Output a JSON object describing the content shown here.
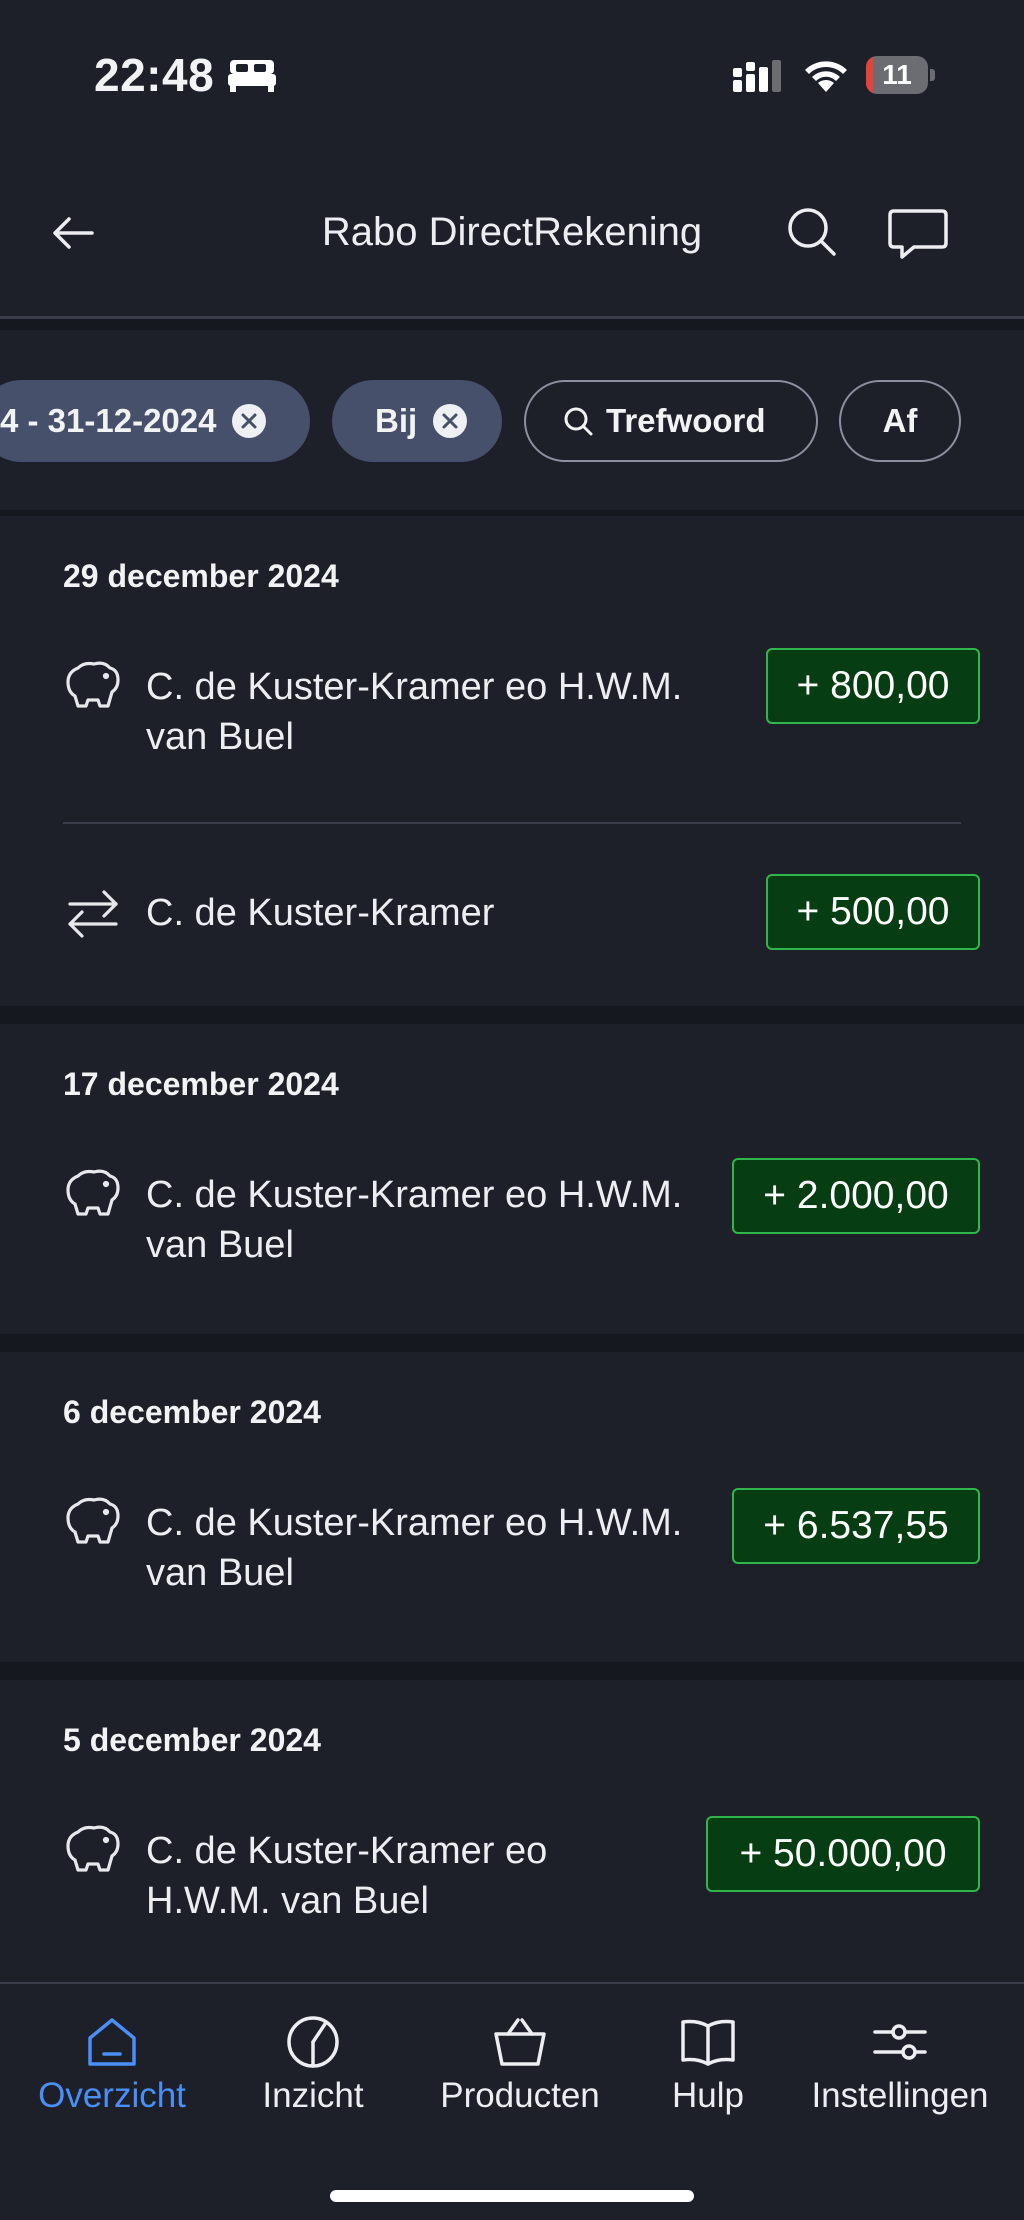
{
  "status_bar": {
    "time": "22:48",
    "battery": "11",
    "battery_level": 0.11,
    "icons": [
      "bed-icon",
      "signal-icon",
      "wifi-icon",
      "battery-icon"
    ]
  },
  "header": {
    "title": "Rabo DirectRekening",
    "icons": [
      "back-arrow-icon",
      "search-icon",
      "chat-icon"
    ]
  },
  "filters": [
    {
      "label": "4 - 31-12-2024",
      "removable": true
    },
    {
      "label": "Bij",
      "removable": true
    },
    {
      "label": "Trefwoord",
      "icon": "search-icon"
    },
    {
      "label": "Af"
    }
  ],
  "groups": [
    {
      "date": "29 december 2024",
      "transactions": [
        {
          "icon": "piggy-bank-icon",
          "name_line1": "C. de Kuster-Kramer eo H.W.M.",
          "name_line2": "van Buel",
          "amount": "+ 800,00"
        },
        {
          "icon": "transfer-icon",
          "name_line1": "C. de Kuster-Kramer",
          "amount": "+ 500,00"
        }
      ]
    },
    {
      "date": "17 december 2024",
      "transactions": [
        {
          "icon": "piggy-bank-icon",
          "name_line1": "C. de Kuster-Kramer eo H.W.M.",
          "name_line2": "van Buel",
          "amount": "+ 2.000,00"
        }
      ]
    },
    {
      "date": "6 december 2024",
      "transactions": [
        {
          "icon": "piggy-bank-icon",
          "name_line1": "C. de Kuster-Kramer eo H.W.M.",
          "name_line2": "van Buel",
          "amount": "+ 6.537,55"
        }
      ]
    },
    {
      "date": "5 december 2024",
      "transactions": [
        {
          "icon": "piggy-bank-icon",
          "name_line1": "C. de Kuster-Kramer eo",
          "name_line2": "H.W.M. van Buel",
          "amount": "+ 50.000,00"
        }
      ]
    }
  ],
  "bottom_nav": [
    {
      "label": "Overzicht",
      "icon": "home-icon",
      "active": true
    },
    {
      "label": "Inzicht",
      "icon": "pie-chart-icon"
    },
    {
      "label": "Producten",
      "icon": "basket-icon"
    },
    {
      "label": "Hulp",
      "icon": "book-icon"
    },
    {
      "label": "Instellingen",
      "icon": "sliders-icon"
    }
  ],
  "colors": {
    "background": "#16181f",
    "surface": "#1d1f29",
    "accent": "#4a8ff7",
    "amount_bg": "#073d12",
    "amount_border": "#2fb54a",
    "chip_filled": "#46506a"
  }
}
